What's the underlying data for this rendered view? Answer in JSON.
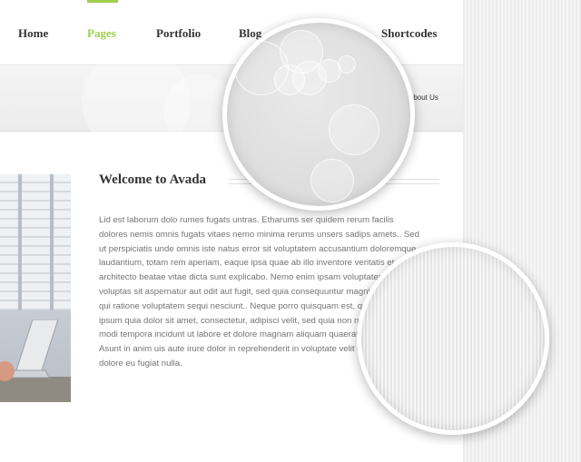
{
  "nav": {
    "items": [
      {
        "label": "Home"
      },
      {
        "label": "Pages"
      },
      {
        "label": "Portfolio"
      },
      {
        "label": "Blog"
      },
      {
        "label": "Shortcodes"
      }
    ],
    "active_index": 1
  },
  "breadcrumb": {
    "label": "About Us"
  },
  "main": {
    "title": "Welcome to Avada",
    "paragraph": "Lid est laborum dolo rumes fugats untras. Etharums ser quidem rerum facilis\ndolores nemis omnis fugats vitaes nemo minima rerums unsers sadips amets.. Sed\nut perspiciatis unde omnis iste natus error sit voluptatem accusantium doloremque\nlaudantium, totam rem aperiam, eaque ipsa quae ab illo inventore veritatis et quasi\narchitecto beatae vitae dicta sunt explicabo. Nemo enim ipsam voluptatem quia\nvoluptas sit aspernatur aut odit aut fugit, sed quia consequuntur magni dolores eos\nqui ratione voluptatem sequi nesciunt.. Neque porro quisquam est, qui dolorem\nipsum quia dolor sit amet, consectetur, adipisci velit, sed quia non numquam eius\nmodi tempora incidunt ut labore et dolore magnam aliquam quaerat voluptatem.\nAsunt in anim uis aute irure dolor in reprehenderit in voluptate velit esse cillum\ndolore eu fugiat nulla."
  },
  "colors": {
    "accent": "#a0ce4e",
    "nav_text": "#333333",
    "body_text": "#747474"
  }
}
